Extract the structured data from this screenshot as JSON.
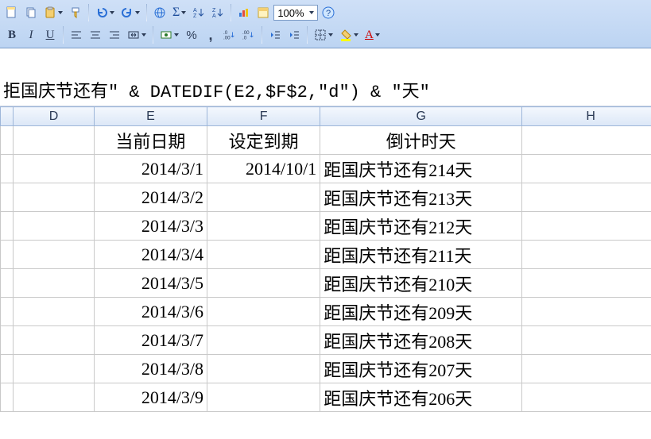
{
  "toolbar": {
    "zoom": "100%",
    "sigma": "Σ",
    "percent": "%",
    "comma": ",",
    "dec_inc": ".00",
    "dec_dec": ".0"
  },
  "formula_bar": "拒国庆节还有\" & DATEDIF(E2,$F$2,\"d\") & \"天\"",
  "columns": {
    "D": "D",
    "E": "E",
    "F": "F",
    "G": "G",
    "H": "H"
  },
  "headers": {
    "E": "当前日期",
    "F": "设定到期",
    "G": "倒计时天"
  },
  "rows": [
    {
      "E": "2014/3/1",
      "F": "2014/10/1",
      "G": "距国庆节还有214天"
    },
    {
      "E": "2014/3/2",
      "F": "",
      "G": "距国庆节还有213天"
    },
    {
      "E": "2014/3/3",
      "F": "",
      "G": "距国庆节还有212天"
    },
    {
      "E": "2014/3/4",
      "F": "",
      "G": "距国庆节还有211天"
    },
    {
      "E": "2014/3/5",
      "F": "",
      "G": "距国庆节还有210天"
    },
    {
      "E": "2014/3/6",
      "F": "",
      "G": "距国庆节还有209天"
    },
    {
      "E": "2014/3/7",
      "F": "",
      "G": "距国庆节还有208天"
    },
    {
      "E": "2014/3/8",
      "F": "",
      "G": "距国庆节还有207天"
    },
    {
      "E": "2014/3/9",
      "F": "",
      "G": "距国庆节还有206天"
    }
  ]
}
